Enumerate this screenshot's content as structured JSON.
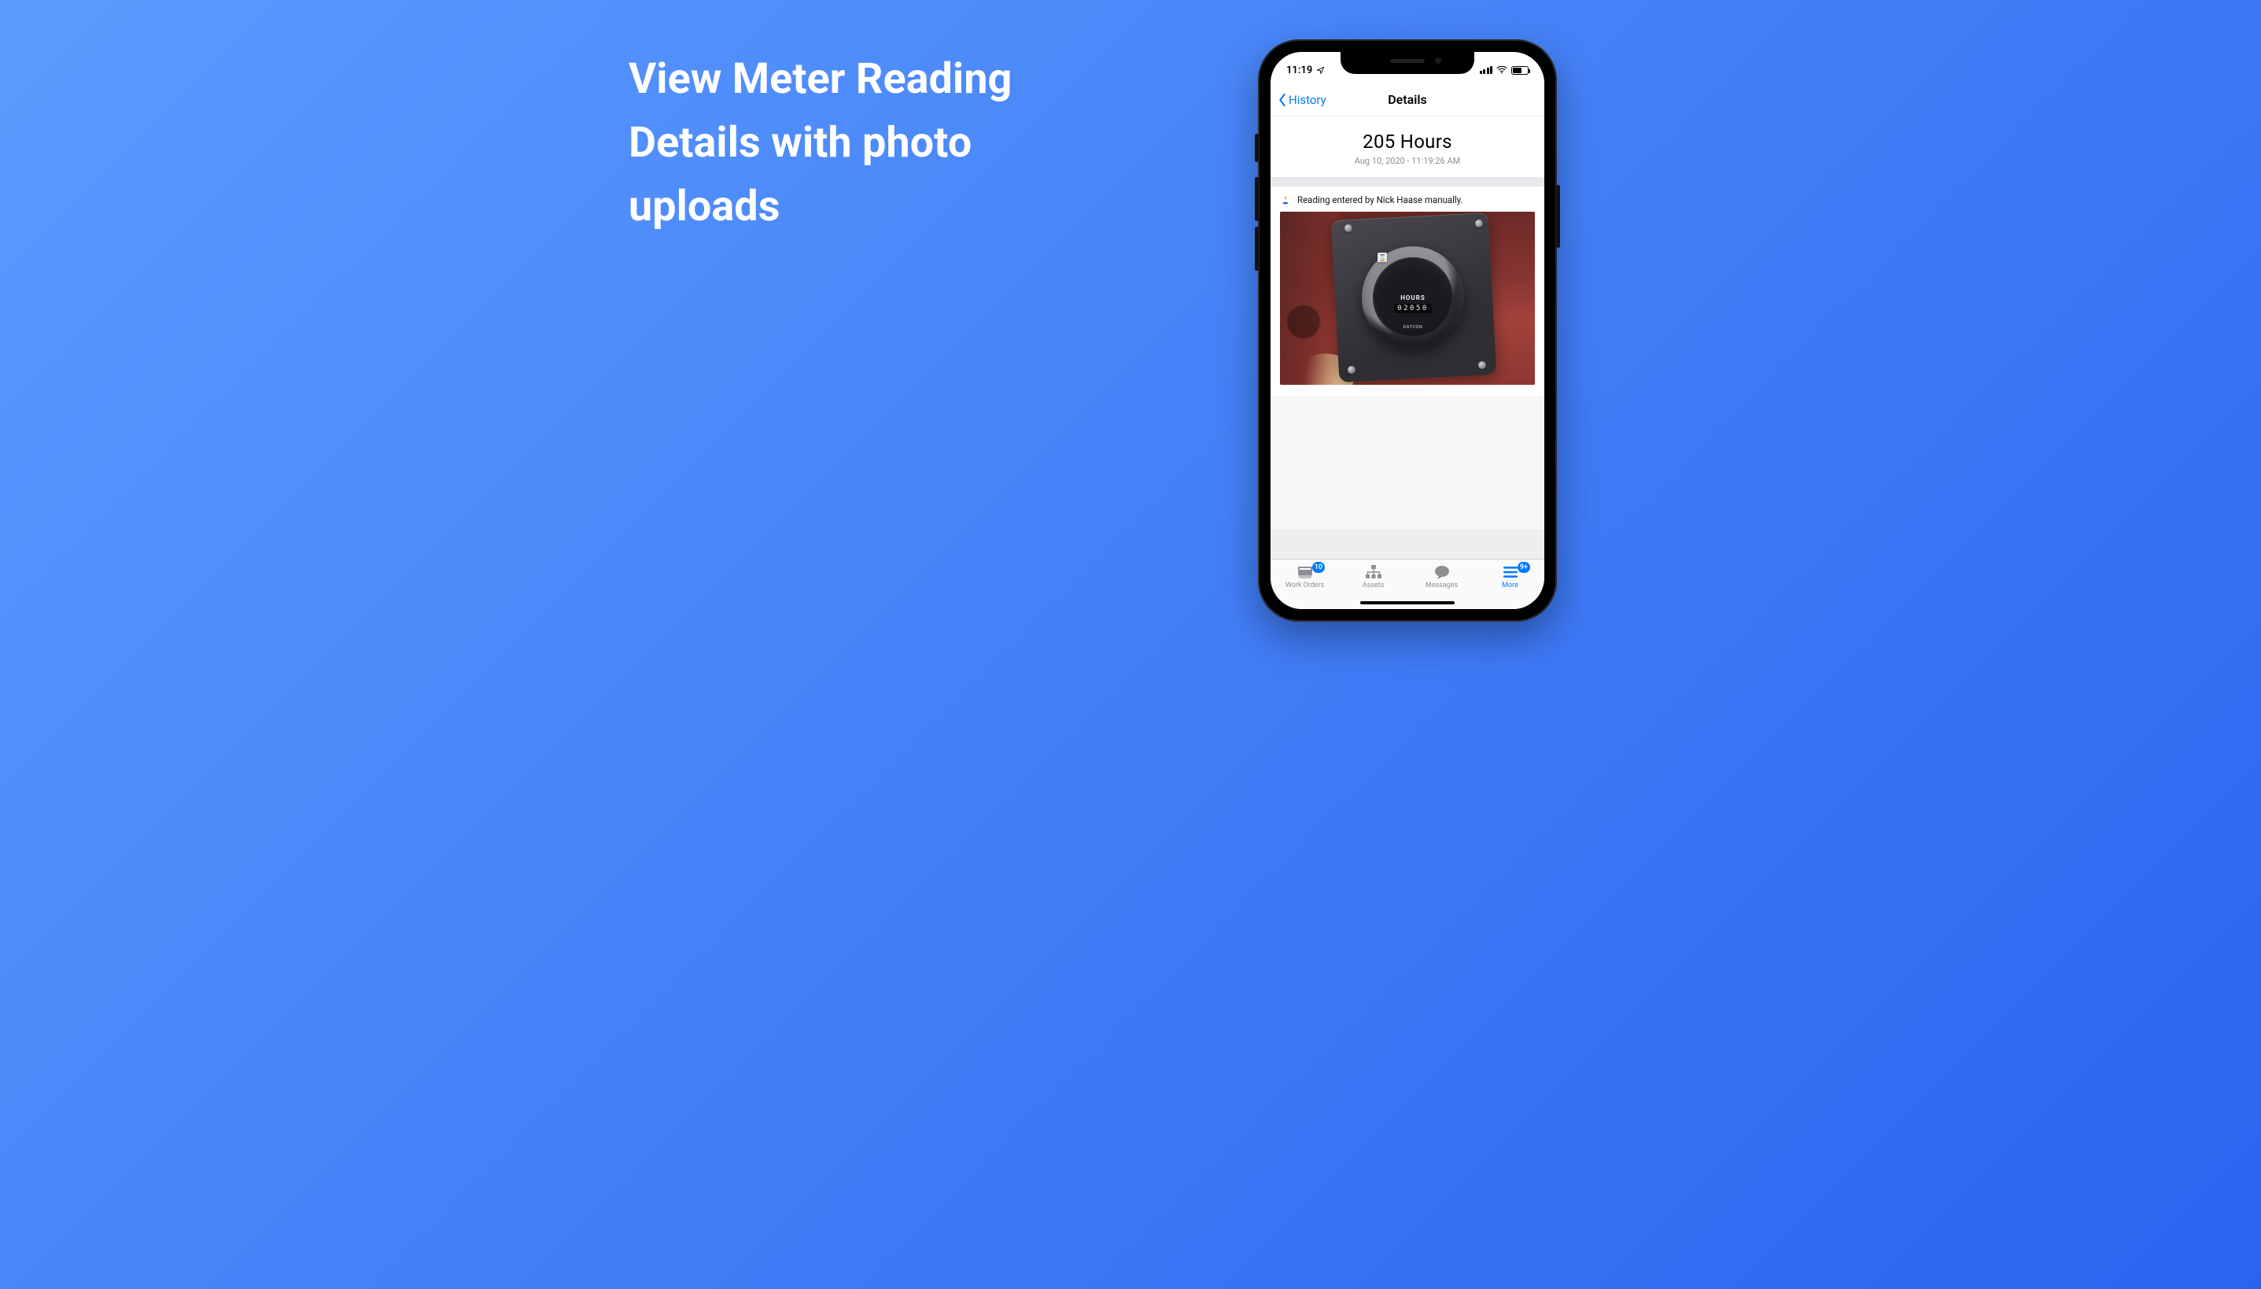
{
  "marketing": {
    "headline": "View Meter Reading Details with photo uploads"
  },
  "statusbar": {
    "time": "11:19"
  },
  "nav": {
    "back_label": "History",
    "title": "Details"
  },
  "reading": {
    "value": "205 Hours",
    "timestamp": "Aug 10, 2020 - 11:19:26 AM",
    "entered_by": "Reading entered by Nick Haase manually."
  },
  "gauge": {
    "label": "HOURS",
    "digits": "02050",
    "brand": "DATCON"
  },
  "tabs": [
    {
      "label": "Work Orders",
      "badge": "10",
      "active": false
    },
    {
      "label": "Assets",
      "badge": null,
      "active": false
    },
    {
      "label": "Messages",
      "badge": null,
      "active": false
    },
    {
      "label": "More",
      "badge": "9+",
      "active": true
    }
  ],
  "colors": {
    "ios_blue": "#007aff"
  }
}
